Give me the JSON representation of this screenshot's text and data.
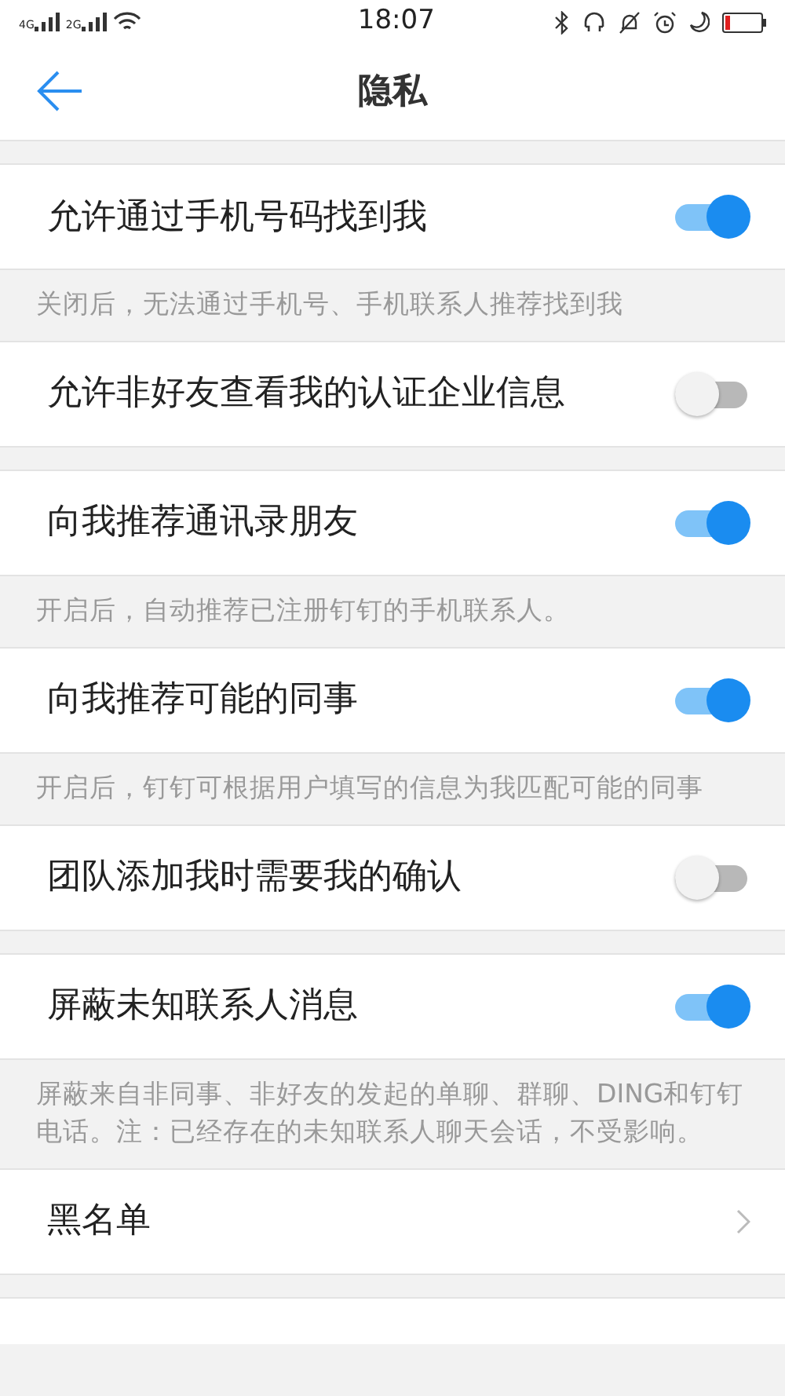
{
  "status_bar": {
    "network_1": "4G",
    "network_2": "2G",
    "time": "18:07"
  },
  "header": {
    "title": "隐私"
  },
  "sections": [
    {
      "kind": "toggle",
      "label": "允许通过手机号码找到我",
      "on": true,
      "note": "关闭后，无法通过手机号、手机联系人推荐找到我"
    },
    {
      "kind": "toggle",
      "label": "允许非好友查看我的认证企业信息",
      "on": false
    },
    {
      "kind": "toggle",
      "label": "向我推荐通讯录朋友",
      "on": true,
      "note": "开启后，自动推荐已注册钉钉的手机联系人。"
    },
    {
      "kind": "toggle",
      "label": "向我推荐可能的同事",
      "on": true,
      "note": "开启后，钉钉可根据用户填写的信息为我匹配可能的同事"
    },
    {
      "kind": "toggle",
      "label": "团队添加我时需要我的确认",
      "on": false
    },
    {
      "kind": "toggle",
      "label": "屏蔽未知联系人消息",
      "on": true,
      "note": "屏蔽来自非同事、非好友的发起的单聊、群聊、DING和钉钉电话。注：已经存在的未知联系人聊天会话，不受影响。"
    },
    {
      "kind": "link",
      "label": "黑名单"
    }
  ]
}
